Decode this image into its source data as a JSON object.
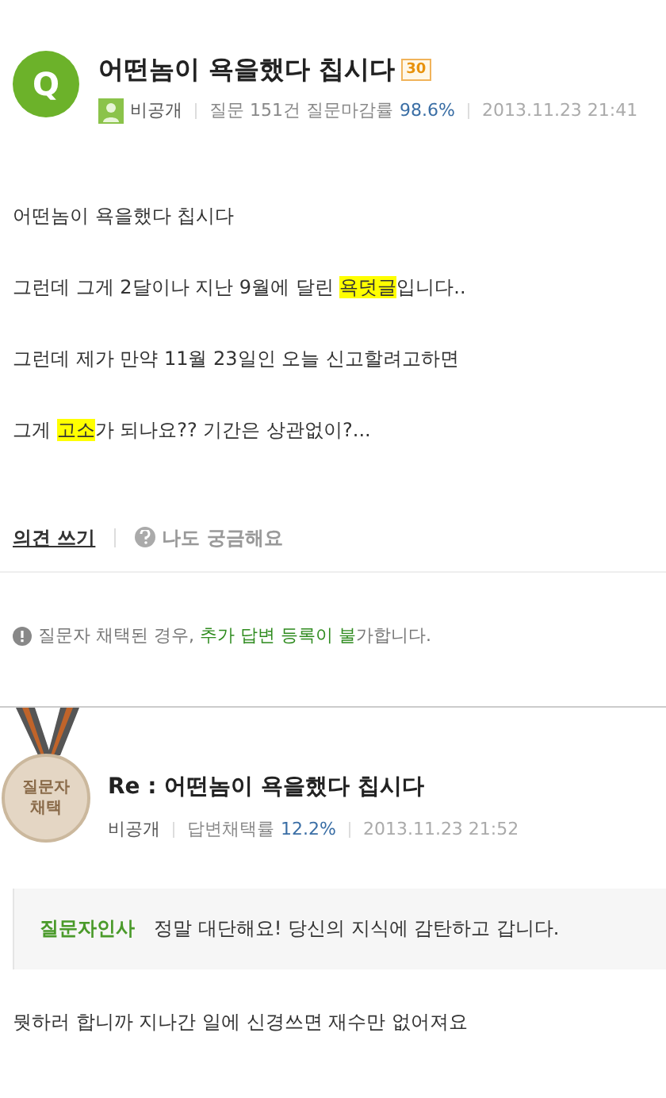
{
  "question": {
    "badge": "Q",
    "title": "어떤놈이 욕을했다 칩시다",
    "points": "30",
    "author": "비공개",
    "stats_label": "질문 151건 질문마감률",
    "stats_value": "98.6%",
    "date": "2013.11.23 21:41"
  },
  "body": [
    [
      {
        "text": "어떤놈이 욕을했다 칩시다",
        "highlight": false
      }
    ],
    [
      {
        "text": "그런데 그게 2달이나 지난 9월에 달린 ",
        "highlight": false
      },
      {
        "text": "욕덧글",
        "highlight": true
      },
      {
        "text": "입니다..",
        "highlight": false
      }
    ],
    [
      {
        "text": "그런데 제가 만약 11월 23일인 오늘 신고할려고하면",
        "highlight": false
      }
    ],
    [
      {
        "text": "그게 ",
        "highlight": false
      },
      {
        "text": "고소",
        "highlight": true
      },
      {
        "text": "가 되나요?? 기간은 상관없이?...",
        "highlight": false
      }
    ]
  ],
  "actions": {
    "comment": "의견 쓰기",
    "curious": "나도 궁금해요"
  },
  "notice": [
    {
      "text": "질문자 채택된 경우, ",
      "emphasis": false
    },
    {
      "text": "추가 답변 등록이 불",
      "emphasis": true
    },
    {
      "text": "가합니다.",
      "emphasis": false
    }
  ],
  "answer": {
    "medal": [
      "질문자",
      "채택"
    ],
    "title": "Re : 어떤놈이 욕을했다 칩시다",
    "author": "비공개",
    "stats_label": "답변채택률",
    "stats_value": "12.2%",
    "date": "2013.11.23 21:52",
    "greeting_label": "질문자인사",
    "greeting": "정말 대단해요! 당신의 지식에 감탄하고 갑니다.",
    "text": "뭣하러 합니까 지나간 일에 신경쓰면 재수만 없어져요"
  }
}
